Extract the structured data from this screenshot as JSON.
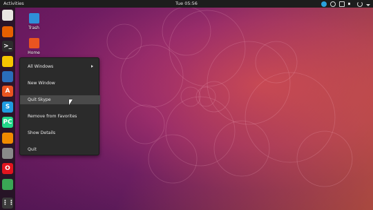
{
  "topbar": {
    "activities_label": "Activities",
    "clock": "Tue 05:56"
  },
  "desktop": {
    "trash_label": "Trash",
    "home_label": "Home"
  },
  "dock": {
    "items": [
      {
        "name": "files",
        "color": "#e8e6e1",
        "glyph": ""
      },
      {
        "name": "firefox",
        "color": "#e66000",
        "glyph": ""
      },
      {
        "name": "terminal",
        "color": "#2d2d2d",
        "glyph": ">_"
      },
      {
        "name": "rhythmbox",
        "color": "#f5c400",
        "glyph": ""
      },
      {
        "name": "libreoffice-writer",
        "color": "#2a6ebb",
        "glyph": ""
      },
      {
        "name": "software",
        "color": "#e95420",
        "glyph": "A"
      },
      {
        "name": "skype",
        "color": "#1f9be0",
        "glyph": "S"
      },
      {
        "name": "pycharm",
        "color": "#21d789",
        "glyph": "PC"
      },
      {
        "name": "vlc",
        "color": "#f08a00",
        "glyph": ""
      },
      {
        "name": "settings",
        "color": "#8a8a8a",
        "glyph": ""
      },
      {
        "name": "opera",
        "color": "#e1141e",
        "glyph": "O"
      },
      {
        "name": "app",
        "color": "#3aa655",
        "glyph": ""
      },
      {
        "name": "show-applications",
        "color": "#3a3a3a",
        "glyph": "⋮⋮"
      }
    ]
  },
  "context_menu": {
    "items": [
      {
        "label": "All Windows",
        "submenu": true
      },
      {
        "label": "New Window",
        "submenu": false
      },
      {
        "label": "Quit Skype",
        "submenu": false,
        "highlighted": true
      },
      {
        "label": "Remove from Favorites",
        "submenu": false
      },
      {
        "label": "Show Details",
        "submenu": false
      },
      {
        "label": "Quit",
        "submenu": false
      }
    ]
  },
  "colors": {
    "topbar_bg": "#1d1d1d",
    "menu_bg": "#2b2b2b",
    "menu_highlight": "#4a4a4a",
    "ubuntu_orange": "#e95420"
  }
}
